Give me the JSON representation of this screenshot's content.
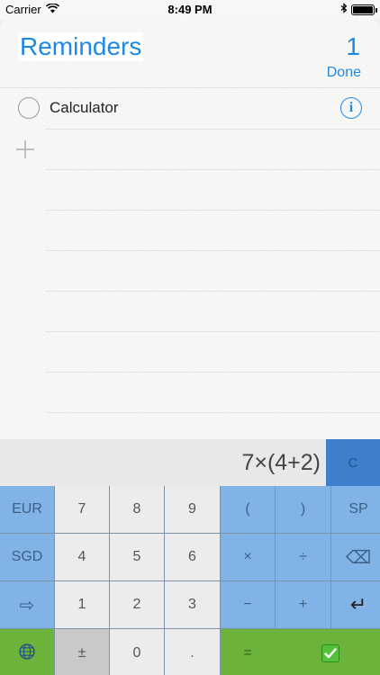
{
  "status_bar": {
    "carrier": "Carrier",
    "time": "8:49 PM",
    "battery_level": 1.0
  },
  "header": {
    "title": "Reminders",
    "count": "1",
    "done_label": "Done"
  },
  "reminders": [
    {
      "text": "Calculator"
    }
  ],
  "calculator": {
    "display": "7×(4+2)",
    "clear_label": "C",
    "rows": [
      [
        "EUR",
        "7",
        "8",
        "9",
        "(",
        ")",
        "SP"
      ],
      [
        "SGD",
        "4",
        "5",
        "6",
        "×",
        "÷",
        "⌫"
      ],
      [
        "⇨",
        "1",
        "2",
        "3",
        "−",
        "+",
        "↵"
      ],
      [
        "",
        "±",
        "0",
        ".",
        "=",
        ""
      ]
    ]
  },
  "colors": {
    "accent": "#1e88e5",
    "key_blue": "#82b3e7",
    "key_blue_dark": "#3d7fca",
    "key_green": "#6cb33c"
  },
  "icons": {
    "wifi": "wifi-icon",
    "globe": "globe-icon",
    "check": "checkmark-icon",
    "info": "info-icon",
    "add": "plus-icon"
  }
}
